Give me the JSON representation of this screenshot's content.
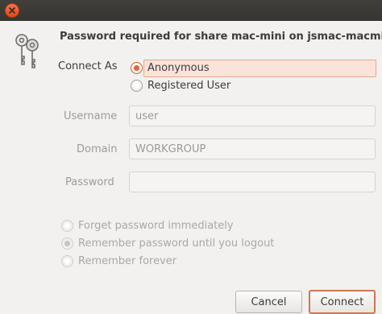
{
  "window": {
    "close_icon": "close-icon"
  },
  "dialog": {
    "icon": "keys-icon",
    "title": "Password required for share mac-mini on jsmac-macmini"
  },
  "connect_as": {
    "label": "Connect As",
    "options": [
      {
        "label": "Anonymous",
        "selected": true
      },
      {
        "label": "Registered User",
        "selected": false
      }
    ]
  },
  "fields": {
    "username": {
      "label": "Username",
      "value": "user"
    },
    "domain": {
      "label": "Domain",
      "value": "WORKGROUP"
    },
    "password": {
      "label": "Password",
      "value": ""
    }
  },
  "remember": {
    "options": [
      {
        "label": "Forget password immediately",
        "selected": false
      },
      {
        "label": "Remember password until you logout",
        "selected": true
      },
      {
        "label": "Remember forever",
        "selected": false
      }
    ]
  },
  "buttons": {
    "cancel": "Cancel",
    "connect": "Connect"
  },
  "colors": {
    "titlebar": "#3c3b37",
    "accent": "#e3652f",
    "background": "#f2f1f0"
  }
}
